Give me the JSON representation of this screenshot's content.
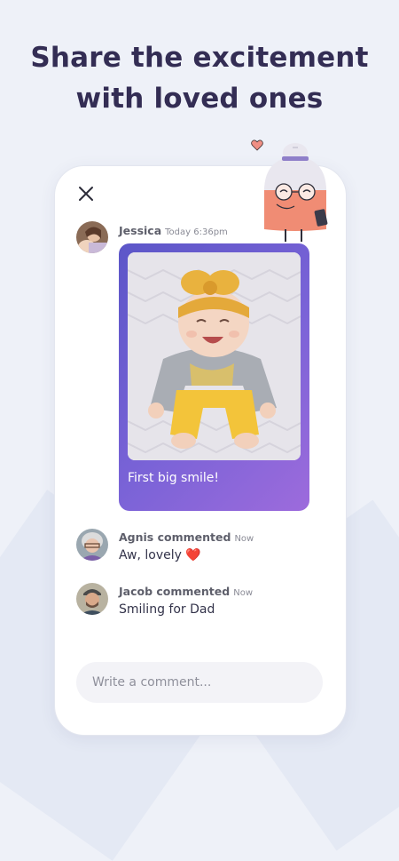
{
  "headline": {
    "line1": "Share the excitement",
    "line2": "with loved ones"
  },
  "post": {
    "author": "Jessica",
    "time": "Today 6:36pm",
    "caption": "First big smile!"
  },
  "comments": [
    {
      "author_line": "Agnis commented",
      "time": "Now",
      "text": "Aw, lovely",
      "emoji": "❤️"
    },
    {
      "author_line": "Jacob commented",
      "time": "Now",
      "text": "Smiling for Dad"
    }
  ],
  "comment_input": {
    "placeholder": "Write a comment..."
  },
  "icons": [
    "close-icon",
    "heart-icon",
    "grandma-illustration"
  ],
  "colors": {
    "headline": "#332d54",
    "card_gradient_start": "#5c56c8",
    "card_gradient_end": "#9d6bdc",
    "heart": "#e0303b"
  }
}
